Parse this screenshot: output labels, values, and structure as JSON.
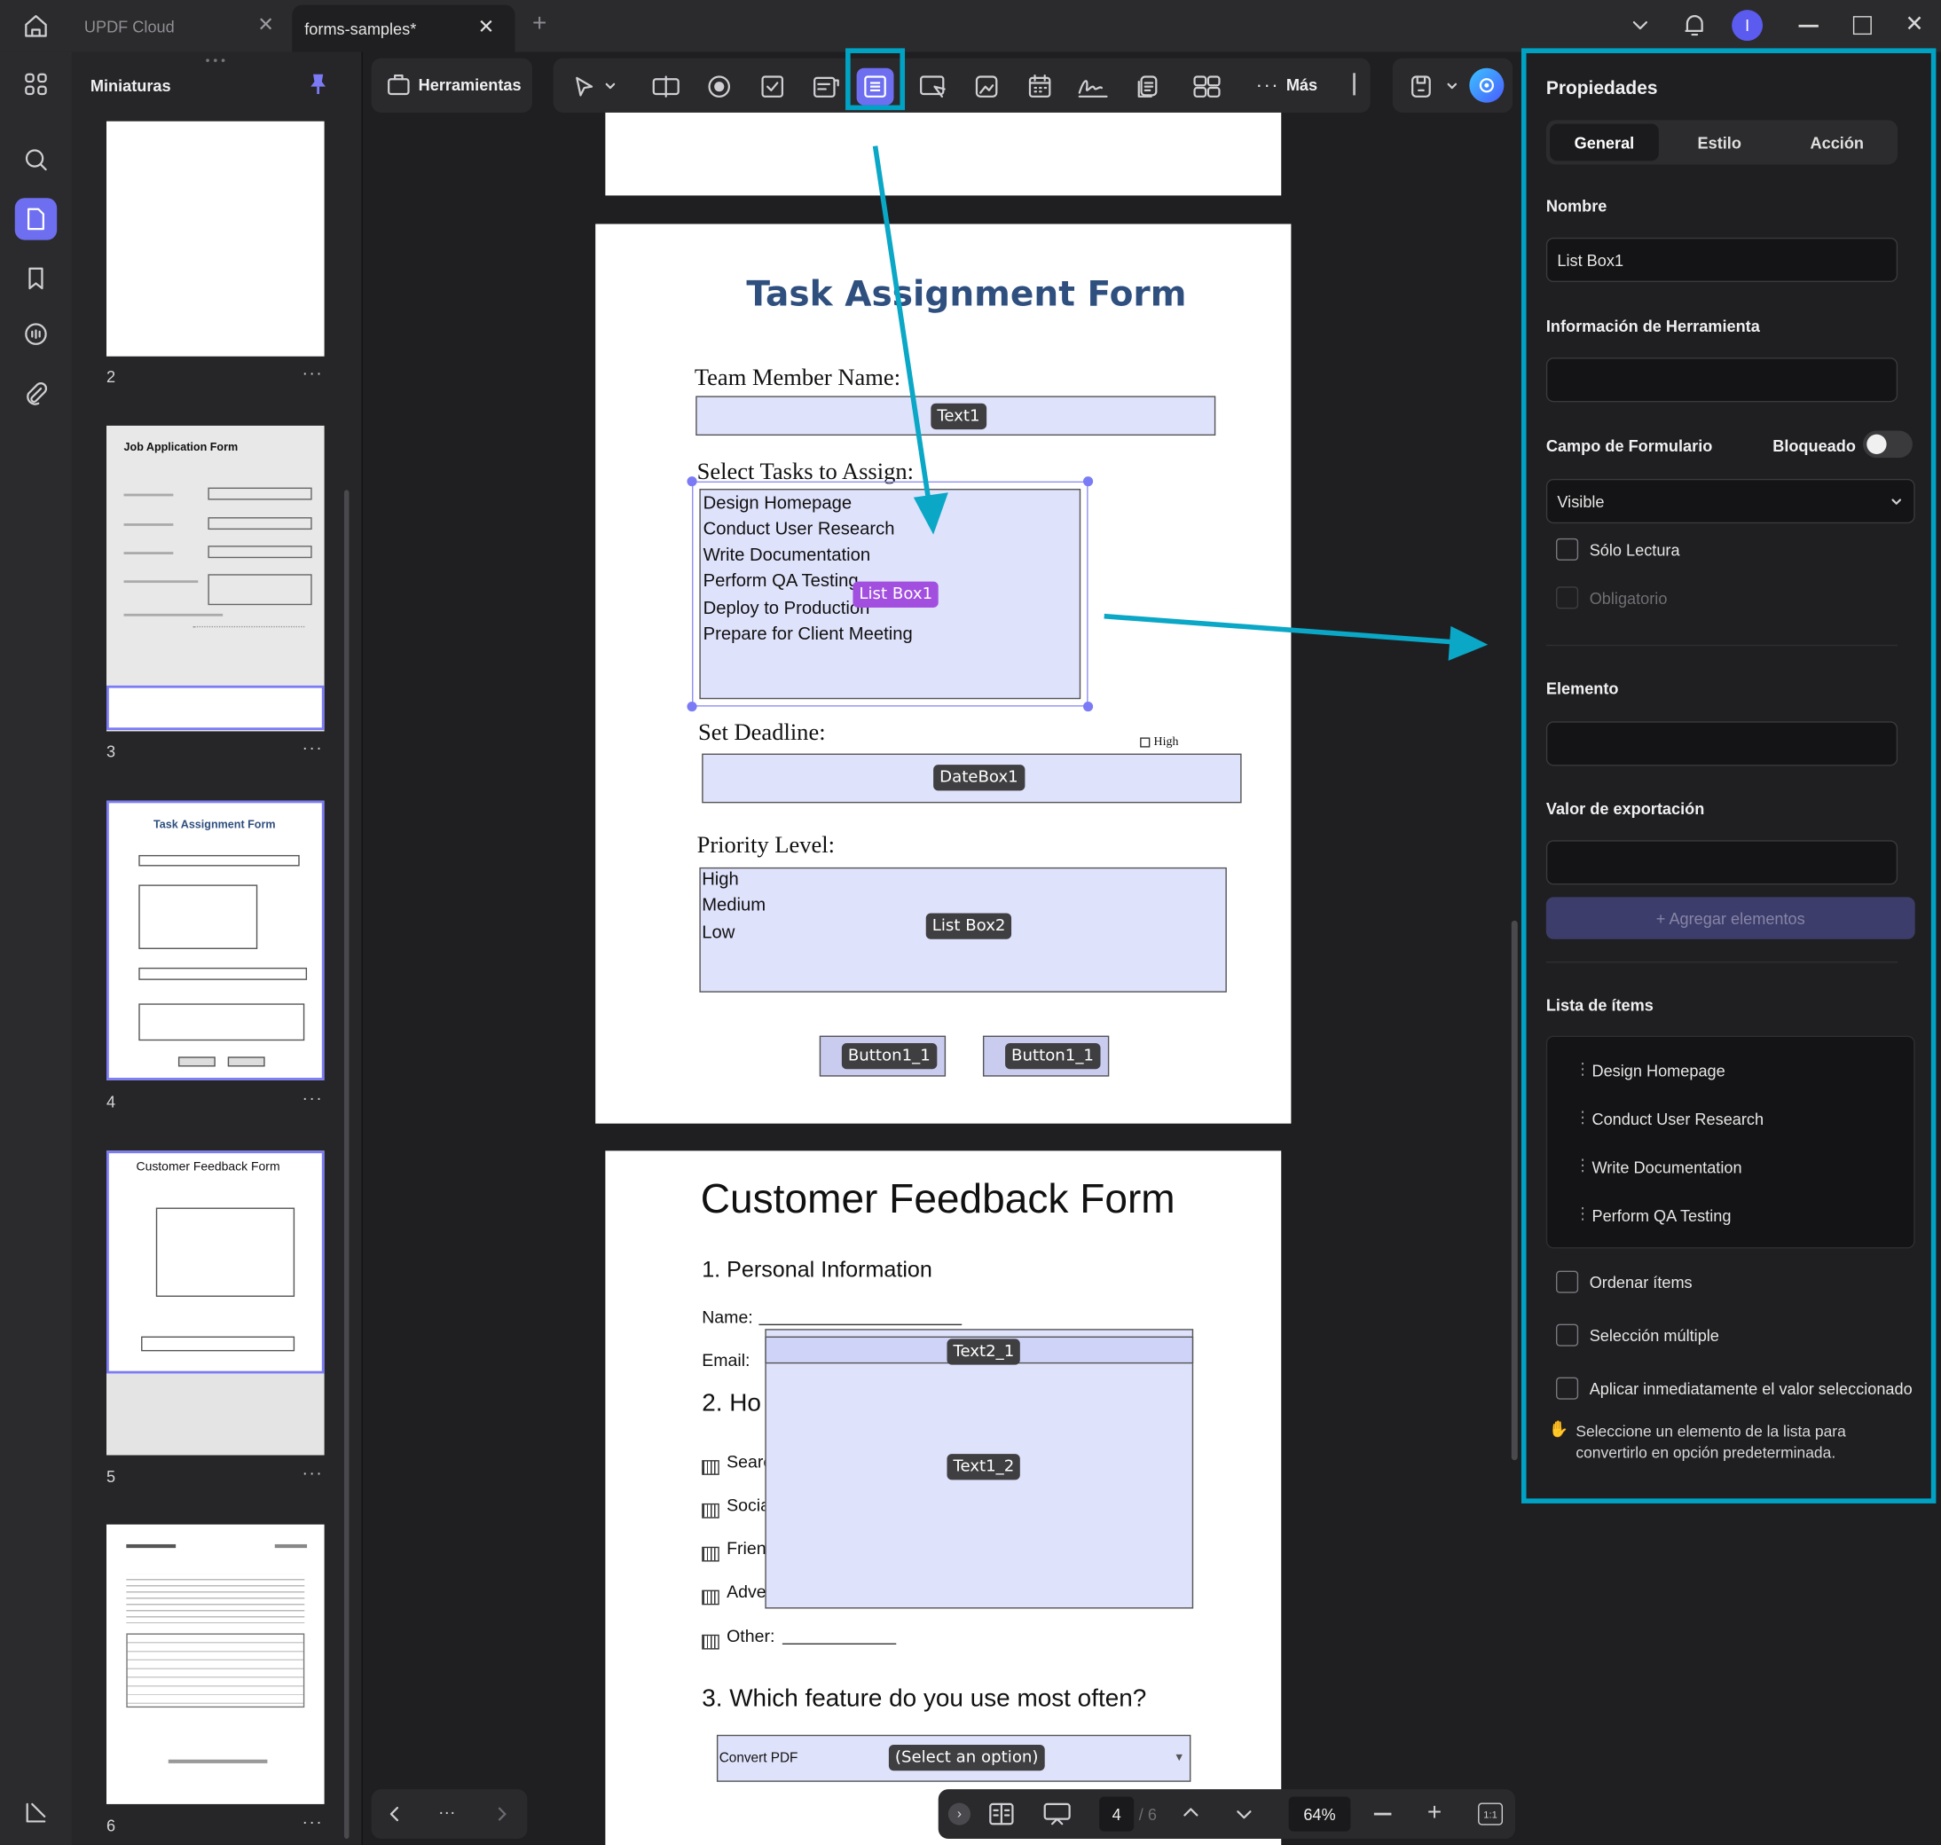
{
  "tabs": {
    "cloud": "UPDF Cloud",
    "doc": "forms-samples*"
  },
  "thumbnails": {
    "title": "Miniaturas",
    "pages": [
      "2",
      "3",
      "4",
      "5",
      "6"
    ],
    "job_title": "Job Application Form",
    "task_title": "Task Assignment Form",
    "feedback_title": "Customer Feedback Form"
  },
  "toolbar": {
    "tools": "Herramientas",
    "more": "Más"
  },
  "page4": {
    "title": "Task Assignment Form",
    "team_label": "Team Member Name:",
    "text1": "Text1",
    "tasks_label": "Select Tasks to Assign:",
    "tasks": [
      "Design Homepage",
      "Conduct User Research",
      "Write Documentation",
      "Perform QA Testing",
      "Deploy to Production",
      "Prepare for Client Meeting"
    ],
    "listbox1": "List Box1",
    "deadline_label": "Set Deadline:",
    "high_label": "High",
    "datebox": "DateBox1",
    "priority_label": "Priority Level:",
    "priorities": [
      "High",
      "Medium",
      "Low"
    ],
    "listbox2": "List Box2",
    "button_a": "Button1_1",
    "button_b": "Button1_1"
  },
  "page5": {
    "title": "Customer Feedback Form",
    "section1": "1. Personal Information",
    "name_label": "Name:",
    "email_label": "Email:",
    "text2_1": "Text2_1",
    "text1_2": "Text1_2",
    "section2": "2. Ho",
    "options": [
      "Searc",
      "Socia",
      "Frien",
      "Adve",
      "Other:"
    ],
    "section3": "3. Which feature do you use most often?",
    "combo_value": "Convert PDF",
    "combo_tag": "(Select an option)"
  },
  "panel": {
    "title": "Propiedades",
    "tabs": [
      "General",
      "Estilo",
      "Acción"
    ],
    "name_label": "Nombre",
    "name_value": "List Box1",
    "tooltip_label": "Información de Herramienta",
    "tooltip_value": "",
    "field_label": "Campo de Formulario",
    "locked_label": "Bloqueado",
    "visibility": "Visible",
    "readonly": "Sólo Lectura",
    "required": "Obligatorio",
    "element_label": "Elemento",
    "export_label": "Valor de exportación",
    "add_items": "+ Agregar elementos",
    "list_label": "Lista de ítems",
    "items": [
      "Design Homepage",
      "Conduct User Research",
      "Write Documentation",
      "Perform QA Testing"
    ],
    "sort": "Ordenar ítems",
    "multi": "Selección múltiple",
    "commit": "Aplicar inmediatamente el valor seleccionado",
    "hint": "Seleccione un elemento de la lista para convertirlo en opción predeterminada."
  },
  "bottombar": {
    "page": "4",
    "total": "/ 6",
    "zoom": "64%",
    "fit": "1:1"
  },
  "colors": {
    "accent": "#00a3c4",
    "selected_tool": "#6e6ef0",
    "field": "#dfe2fb",
    "title_blue": "#2f4f7f"
  }
}
